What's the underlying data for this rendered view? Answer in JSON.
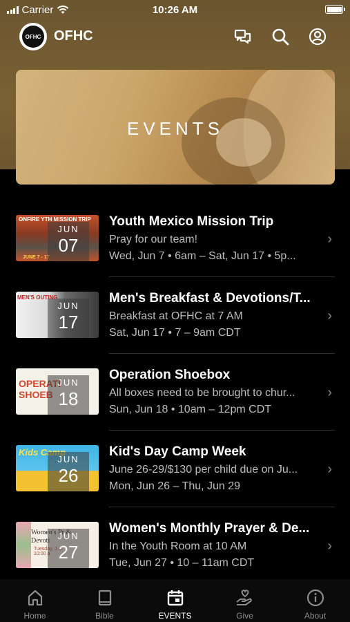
{
  "status_bar": {
    "carrier": "Carrier",
    "time": "10:26 AM"
  },
  "app": {
    "logo_text": "OFHC",
    "title": "OFHC"
  },
  "banner": {
    "title": "EVENTS"
  },
  "events": [
    {
      "title": "Youth Mexico Mission Trip",
      "subtitle": "Pray for our team!",
      "when": "Wed, Jun 7 • 6am – Sat, Jun 17 • 5p...",
      "month": "JUN",
      "day": "07",
      "thumb_caption": "ONFIRE YTH MISSION TRIP",
      "thumb_caption2": "JUNE 7 - 17"
    },
    {
      "title": "Men's Breakfast & Devotions/T...",
      "subtitle": "Breakfast at OFHC at 7 AM",
      "when": "Sat, Jun 17 • 7 – 9am CDT",
      "month": "JUN",
      "day": "17",
      "thumb_caption": "MEN'S OUTING"
    },
    {
      "title": "Operation Shoebox",
      "subtitle": "All boxes need to be brought to chur...",
      "when": "Sun, Jun 18 • 10am – 12pm CDT",
      "month": "JUN",
      "day": "18",
      "thumb_caption": "OPERATI SHOEB"
    },
    {
      "title": "Kid's Day Camp Week",
      "subtitle": "June 26-29/$130 per child due on Ju...",
      "when": "Mon, Jun 26 – Thu, Jun 29",
      "month": "JUN",
      "day": "26",
      "thumb_caption": "Kids Camp"
    },
    {
      "title": "Women's Monthly Prayer & De...",
      "subtitle": "In the Youth Room at 10 AM",
      "when": "Tue, Jun 27 • 10 – 11am CDT",
      "month": "JUN",
      "day": "27",
      "thumb_caption": "Women's Pr & Devoti",
      "thumb_caption2": "Tuesday, J at 10:00 a"
    }
  ],
  "tabs": [
    {
      "label": "Home",
      "icon": "home-icon",
      "active": false
    },
    {
      "label": "Bible",
      "icon": "book-icon",
      "active": false
    },
    {
      "label": "EVENTS",
      "icon": "calendar-icon",
      "active": true
    },
    {
      "label": "Give",
      "icon": "hand-heart-icon",
      "active": false
    },
    {
      "label": "About",
      "icon": "info-icon",
      "active": false
    }
  ],
  "colors": {
    "header_brown": "#7a6133",
    "background": "#000000",
    "inactive_tab": "#8d8d8d"
  }
}
